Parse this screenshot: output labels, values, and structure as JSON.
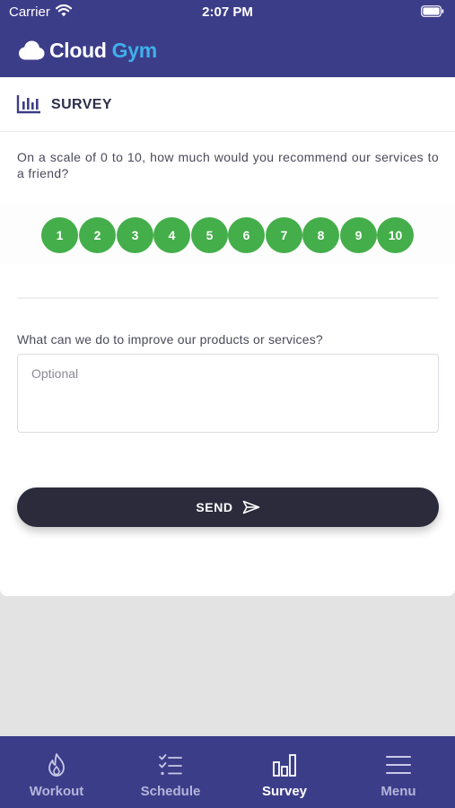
{
  "status_bar": {
    "carrier": "Carrier",
    "time": "2:07 PM"
  },
  "brand": {
    "word1": "Cloud",
    "word2": "Gym",
    "accent": "#3fb0ea",
    "header_bg": "#3c3d89"
  },
  "survey": {
    "title": "SURVEY",
    "question1": "On a scale of 0 to 10, how much would you recommend our services to a friend?",
    "scores": [
      "1",
      "2",
      "3",
      "4",
      "5",
      "6",
      "7",
      "8",
      "9",
      "10"
    ],
    "score_color": "#44ae4a",
    "question2": "What can we do to improve our products or services?",
    "comment_placeholder": "Optional",
    "comment_value": "",
    "send_label": "SEND"
  },
  "tabs": [
    {
      "label": "Workout",
      "icon": "flame-icon",
      "active": false
    },
    {
      "label": "Schedule",
      "icon": "checklist-icon",
      "active": false
    },
    {
      "label": "Survey",
      "icon": "bar-chart-icon",
      "active": true
    },
    {
      "label": "Menu",
      "icon": "hamburger-menu-icon",
      "active": false
    }
  ]
}
